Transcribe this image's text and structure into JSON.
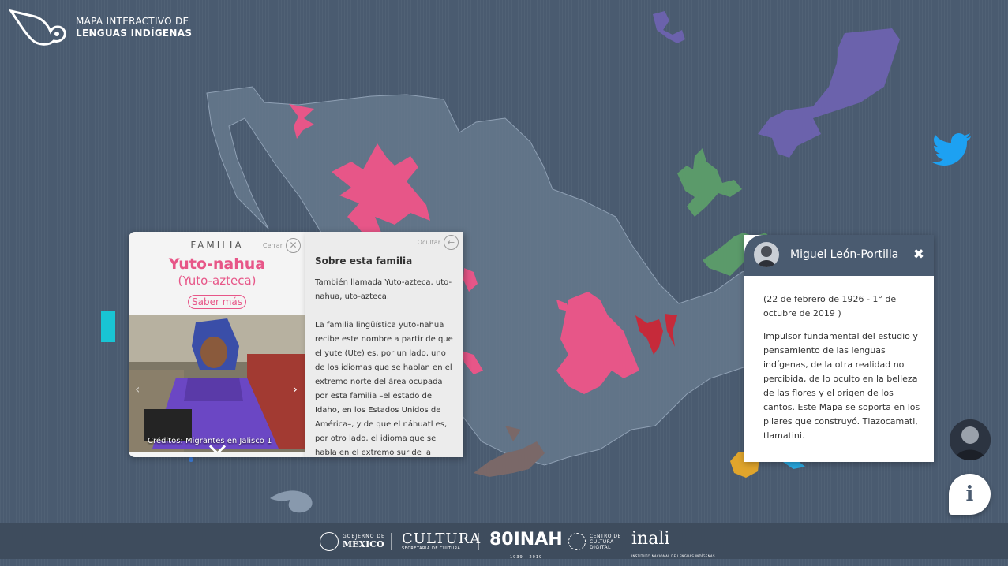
{
  "app": {
    "title_line1": "MAPA INTERACTIVO DE",
    "title_line2": "LENGUAS INDÍGENAS"
  },
  "colors": {
    "background": "#4a5b70",
    "accent_pink": "#e75688",
    "region_purple": "#6b62ac",
    "region_green": "#5b9a6a",
    "region_red": "#c62a3a",
    "region_brown": "#7a6868",
    "region_yellow": "#e0a52c",
    "cyan": "#19c4d4",
    "twitter_blue": "#1da1f2"
  },
  "family_card": {
    "label": "FAMILIA",
    "close_label": "Cerrar",
    "name": "Yuto-nahua",
    "alt_name": "(Yuto-azteca)",
    "more_button": "Saber más",
    "photo_credit": "Créditos: Migrantes en Jalisco 1",
    "icons": [
      "close-icon",
      "chevron-right-icon",
      "chevron-left-icon",
      "chevron-down-icon"
    ]
  },
  "info_panel": {
    "hide_label": "Ocultar",
    "heading": "Sobre esta familia",
    "paragraph1": "También llamada Yuto-azteca, uto-nahua, uto-azteca.",
    "paragraph2": "La familia lingüística yuto-nahua recibe este nombre a partir de que el yute (Ute) es, por un lado, uno de los idiomas que se hablan en el extremo norte del área ocupada por esta familia –el estado de Idaho, en los Estados Unidos de América–, y de que el náhuatl es, por otro lado, el idioma que se habla en el extremo sur de la misma área. La familia yuto-nahua es una de las que abarca mayor territorio en el continente americano"
  },
  "profile": {
    "name": "Miguel León-Portilla",
    "dates": "(22 de febrero de 1926 - 1° de octubre de 2019 )",
    "bio": "Impulsor fundamental del estudio y pensamiento de las lenguas indígenas, de la otra realidad no percibida, de lo oculto en la belleza de las flores y el origen de los cantos. Este Mapa se soporta en los pilares que construyó. Tlazocamati, tlamatini.",
    "close_glyph": "✖"
  },
  "buttons": {
    "info_glyph": "i",
    "twitter": "twitter-icon"
  },
  "footer": {
    "gob_line1": "GOBIERNO DE",
    "gob_line2": "MÉXICO",
    "cultura": "CULTURA",
    "cultura_sub": "SECRETARÍA DE CULTURA",
    "inah": "80INAH",
    "inah_sub": "1939 · 2019",
    "ccd": "CENTRO DE CULTURA DIGITAL",
    "inali": "inali",
    "inali_sub": "INSTITUTO NACIONAL DE LENGUAS INDÍGENAS"
  }
}
